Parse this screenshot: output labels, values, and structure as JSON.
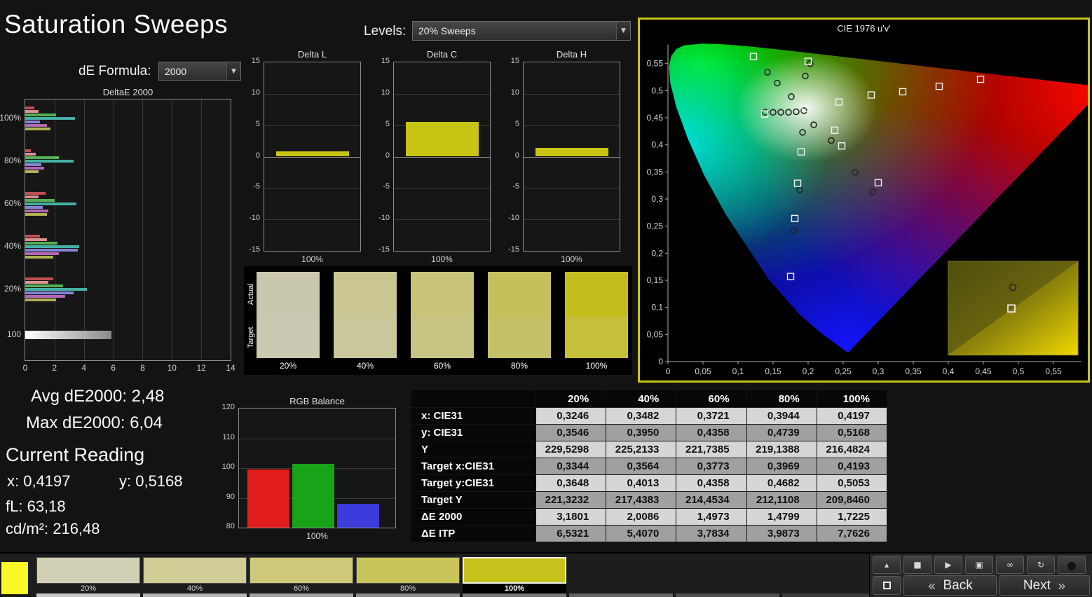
{
  "page": {
    "title": "Saturation Sweeps"
  },
  "controls": {
    "de_formula_label": "dE Formula:",
    "de_formula_value": "2000",
    "levels_label": "Levels:",
    "levels_value": "20% Sweeps",
    "dropdown_arrow": "▼"
  },
  "stats": {
    "avg": "Avg dE2000: 2,48",
    "max": "Max dE2000: 6,04",
    "current_reading_title": "Current Reading",
    "x_value": "x: 0,4197",
    "y_value": "y: 0,5168",
    "fl_value": "fL: 63,18",
    "cd_value": "cd/m²: 216,48"
  },
  "swatch_panel": {
    "row_labels": [
      "Actual",
      "Target"
    ],
    "swatches": [
      {
        "label": "20%",
        "actual": "#c9c7ad",
        "target": "#cbc9b2"
      },
      {
        "label": "40%",
        "actual": "#c9c693",
        "target": "#cac79a"
      },
      {
        "label": "60%",
        "actual": "#c7c379",
        "target": "#c8c483"
      },
      {
        "label": "80%",
        "actual": "#c5c05c",
        "target": "#c6c168"
      },
      {
        "label": "100%",
        "actual": "#c4bd1e",
        "target": "#c5bf3a"
      }
    ]
  },
  "table": {
    "headers": [
      "20%",
      "40%",
      "60%",
      "80%",
      "100%"
    ],
    "rows": [
      {
        "label": "x: CIE31",
        "values": [
          "0,3246",
          "0,3482",
          "0,3721",
          "0,3944",
          "0,4197"
        ]
      },
      {
        "label": "y: CIE31",
        "values": [
          "0,3546",
          "0,3950",
          "0,4358",
          "0,4739",
          "0,5168"
        ]
      },
      {
        "label": "Y",
        "values": [
          "229,5298",
          "225,2133",
          "221,7385",
          "219,1388",
          "216,4824"
        ]
      },
      {
        "label": "Target x:CIE31",
        "values": [
          "0,3344",
          "0,3564",
          "0,3773",
          "0,3969",
          "0,4193"
        ]
      },
      {
        "label": "Target y:CIE31",
        "values": [
          "0,3648",
          "0,4013",
          "0,4358",
          "0,4682",
          "0,5053"
        ]
      },
      {
        "label": "Target Y",
        "values": [
          "221,3232",
          "217,4383",
          "214,4534",
          "212,1108",
          "209,8460"
        ]
      },
      {
        "label": "ΔE 2000",
        "values": [
          "3,1801",
          "2,0086",
          "1,4973",
          "1,4799",
          "1,7225"
        ]
      },
      {
        "label": "ΔE ITP",
        "values": [
          "6,5321",
          "5,4070",
          "3,7834",
          "3,9873",
          "7,7626"
        ]
      }
    ]
  },
  "bottom_bar": {
    "current_patch_color": "#f8f826",
    "patches": [
      {
        "label": "20%",
        "color": "#d2d0b4",
        "selected": false
      },
      {
        "label": "40%",
        "color": "#d0cd96",
        "selected": false
      },
      {
        "label": "60%",
        "color": "#cdc978",
        "selected": false
      },
      {
        "label": "80%",
        "color": "#cac55b",
        "selected": false
      },
      {
        "label": "100%",
        "color": "#c8c21d",
        "selected": true
      }
    ],
    "next_row_colors": [
      "#c8c8c8",
      "#b4b4b4",
      "#a0a0a0",
      "#8c8c8c",
      "#787878",
      "#646464",
      "#505050",
      "#3c3c3c"
    ],
    "transport": [
      {
        "name": "eject",
        "glyph": "▴"
      },
      {
        "name": "stop",
        "glyph": "■"
      },
      {
        "name": "play",
        "glyph": "▶"
      },
      {
        "name": "pattern-window",
        "glyph": "▣"
      },
      {
        "name": "continuous",
        "glyph": "∞"
      },
      {
        "name": "loop",
        "glyph": "↻"
      },
      {
        "name": "status",
        "glyph": "●"
      }
    ],
    "back_chevron": "«",
    "back_label": "Back",
    "next_label": "Next",
    "next_chevron": "»"
  },
  "chart_data": [
    {
      "id": "deltae2000",
      "type": "bar",
      "title": "DeltaE 2000",
      "orientation": "horizontal",
      "xlim": [
        0,
        14
      ],
      "x_ticks": [
        0,
        2,
        4,
        6,
        8,
        10,
        12,
        14
      ],
      "groups": [
        {
          "label": "100%",
          "bars": [
            {
              "color": "#c05050",
              "value": 0.6
            },
            {
              "color": "#dd9090",
              "value": 0.9
            },
            {
              "color": "#55b055",
              "value": 2.1
            },
            {
              "color": "#45b0a5",
              "value": 3.4
            },
            {
              "color": "#8585d5",
              "value": 1.0
            },
            {
              "color": "#b565b5",
              "value": 1.5
            },
            {
              "color": "#b0b055",
              "value": 1.7
            }
          ]
        },
        {
          "label": "80%",
          "bars": [
            {
              "color": "#c05050",
              "value": 0.4
            },
            {
              "color": "#dd9090",
              "value": 0.7
            },
            {
              "color": "#55b055",
              "value": 2.3
            },
            {
              "color": "#45b0a5",
              "value": 3.3
            },
            {
              "color": "#8585d5",
              "value": 1.1
            },
            {
              "color": "#b565b5",
              "value": 1.3
            },
            {
              "color": "#b0b055",
              "value": 0.9
            }
          ]
        },
        {
          "label": "60%",
          "bars": [
            {
              "color": "#c05050",
              "value": 1.4
            },
            {
              "color": "#dd9090",
              "value": 0.9
            },
            {
              "color": "#55b055",
              "value": 2.0
            },
            {
              "color": "#45b0a5",
              "value": 3.5
            },
            {
              "color": "#8585d5",
              "value": 1.2
            },
            {
              "color": "#b565b5",
              "value": 1.6
            },
            {
              "color": "#b0b055",
              "value": 1.5
            }
          ]
        },
        {
          "label": "40%",
          "bars": [
            {
              "color": "#c05050",
              "value": 1.0
            },
            {
              "color": "#dd9090",
              "value": 1.5
            },
            {
              "color": "#55b055",
              "value": 2.2
            },
            {
              "color": "#45b0a5",
              "value": 3.7
            },
            {
              "color": "#8585d5",
              "value": 3.6
            },
            {
              "color": "#b565b5",
              "value": 2.3
            },
            {
              "color": "#b0b055",
              "value": 1.9
            }
          ]
        },
        {
          "label": "20%",
          "bars": [
            {
              "color": "#c05050",
              "value": 1.9
            },
            {
              "color": "#dd9090",
              "value": 1.6
            },
            {
              "color": "#55b055",
              "value": 2.6
            },
            {
              "color": "#45b0a5",
              "value": 4.2
            },
            {
              "color": "#8585d5",
              "value": 3.3
            },
            {
              "color": "#b565b5",
              "value": 2.7
            },
            {
              "color": "#b0b055",
              "value": 2.1
            }
          ]
        },
        {
          "label": "100",
          "bars": [
            {
              "color": "#ffffff",
              "value": 5.9,
              "height": 12,
              "gradient": true
            }
          ]
        }
      ]
    },
    {
      "id": "delta_l",
      "type": "bar",
      "title": "Delta L",
      "categories": [
        "100%"
      ],
      "values": [
        0.8
      ],
      "ylim": [
        -15,
        15
      ],
      "y_ticks": [
        15,
        10,
        5,
        0,
        -5,
        -10,
        -15
      ],
      "bar_color": "#c8c414",
      "xlabel": "100%"
    },
    {
      "id": "delta_c",
      "type": "bar",
      "title": "Delta C",
      "categories": [
        "100%"
      ],
      "values": [
        5.5
      ],
      "ylim": [
        -15,
        15
      ],
      "y_ticks": [
        15,
        10,
        5,
        0,
        -5,
        -10,
        -15
      ],
      "bar_color": "#c8c414",
      "xlabel": "100%"
    },
    {
      "id": "delta_h",
      "type": "bar",
      "title": "Delta H",
      "categories": [
        "100%"
      ],
      "values": [
        1.4
      ],
      "ylim": [
        -15,
        15
      ],
      "y_ticks": [
        15,
        10,
        5,
        0,
        -5,
        -10,
        -15
      ],
      "bar_color": "#c8c414",
      "xlabel": "100%"
    },
    {
      "id": "rgb_balance",
      "type": "bar",
      "title": "RGB Balance",
      "categories": [
        "Red",
        "Green",
        "Blue"
      ],
      "values": [
        99.6,
        101.4,
        87.9
      ],
      "colors": [
        "#e31c1c",
        "#19a319",
        "#3c3cdd"
      ],
      "ylim": [
        80,
        120
      ],
      "y_ticks": [
        120,
        110,
        100,
        90,
        80
      ],
      "xlabel": "100%"
    },
    {
      "id": "cie_diagram",
      "type": "scatter",
      "title": "CIE 1976 u'v'",
      "xlim": [
        0,
        0.6
      ],
      "ylim": [
        0,
        0.6
      ],
      "x_tick_labels": [
        "0",
        "0,05",
        "0,1",
        "0,15",
        "0,2",
        "0,25",
        "0,3",
        "0,35",
        "0,4",
        "0,45",
        "0,5",
        "0,55"
      ],
      "y_tick_labels": [
        "0",
        "0,05",
        "0,1",
        "0,15",
        "0,2",
        "0,25",
        "0,3",
        "0,35",
        "0,4",
        "0,45",
        "0,5",
        "0,55"
      ],
      "locus": [
        [
          0.2568,
          0.0166
        ],
        [
          0.2161,
          0.0549
        ],
        [
          0.1877,
          0.0871
        ],
        [
          0.1441,
          0.151
        ],
        [
          0.0828,
          0.2708
        ],
        [
          0.0521,
          0.3427
        ],
        [
          0.0282,
          0.4117
        ],
        [
          0.0119,
          0.4699
        ],
        [
          0.0035,
          0.5131
        ],
        [
          0.0014,
          0.5432
        ],
        [
          0.0046,
          0.5638
        ],
        [
          0.0123,
          0.577
        ],
        [
          0.0231,
          0.5837
        ],
        [
          0.0501,
          0.5868
        ],
        [
          0.0792,
          0.5856
        ],
        [
          0.1127,
          0.5821
        ],
        [
          0.1531,
          0.5766
        ],
        [
          0.2026,
          0.5694
        ],
        [
          0.2623,
          0.5604
        ],
        [
          0.3315,
          0.5501
        ],
        [
          0.4035,
          0.5393
        ],
        [
          0.4692,
          0.5296
        ],
        [
          0.5202,
          0.5219
        ],
        [
          0.583,
          0.5125
        ],
        [
          0.6234,
          0.5065
        ]
      ],
      "targets": [
        [
          0.122,
          0.563
        ],
        [
          0.2,
          0.554
        ],
        [
          0.196,
          0.467
        ],
        [
          0.138,
          0.457
        ],
        [
          0.244,
          0.479
        ],
        [
          0.29,
          0.492
        ],
        [
          0.335,
          0.498
        ],
        [
          0.387,
          0.508
        ],
        [
          0.446,
          0.521
        ],
        [
          0.238,
          0.427
        ],
        [
          0.248,
          0.398
        ],
        [
          0.19,
          0.387
        ],
        [
          0.3,
          0.33
        ],
        [
          0.185,
          0.329
        ],
        [
          0.181,
          0.264
        ],
        [
          0.175,
          0.157
        ]
      ],
      "measurements": [
        [
          0.176,
          0.489
        ],
        [
          0.156,
          0.514
        ],
        [
          0.142,
          0.534
        ],
        [
          0.203,
          0.55
        ],
        [
          0.196,
          0.527
        ],
        [
          0.139,
          0.46
        ],
        [
          0.15,
          0.46
        ],
        [
          0.161,
          0.46
        ],
        [
          0.172,
          0.46
        ],
        [
          0.183,
          0.461
        ],
        [
          0.194,
          0.463
        ],
        [
          0.208,
          0.437
        ],
        [
          0.192,
          0.423
        ],
        [
          0.233,
          0.408
        ],
        [
          0.267,
          0.349
        ],
        [
          0.188,
          0.317
        ],
        [
          0.18,
          0.242
        ],
        [
          0.292,
          0.313
        ]
      ],
      "inset": {
        "x0": 0.4,
        "y0": 0.012,
        "x1": 0.585,
        "y1": 0.185,
        "circle": [
          0.492,
          0.137
        ],
        "square": [
          0.49,
          0.098
        ]
      }
    }
  ]
}
